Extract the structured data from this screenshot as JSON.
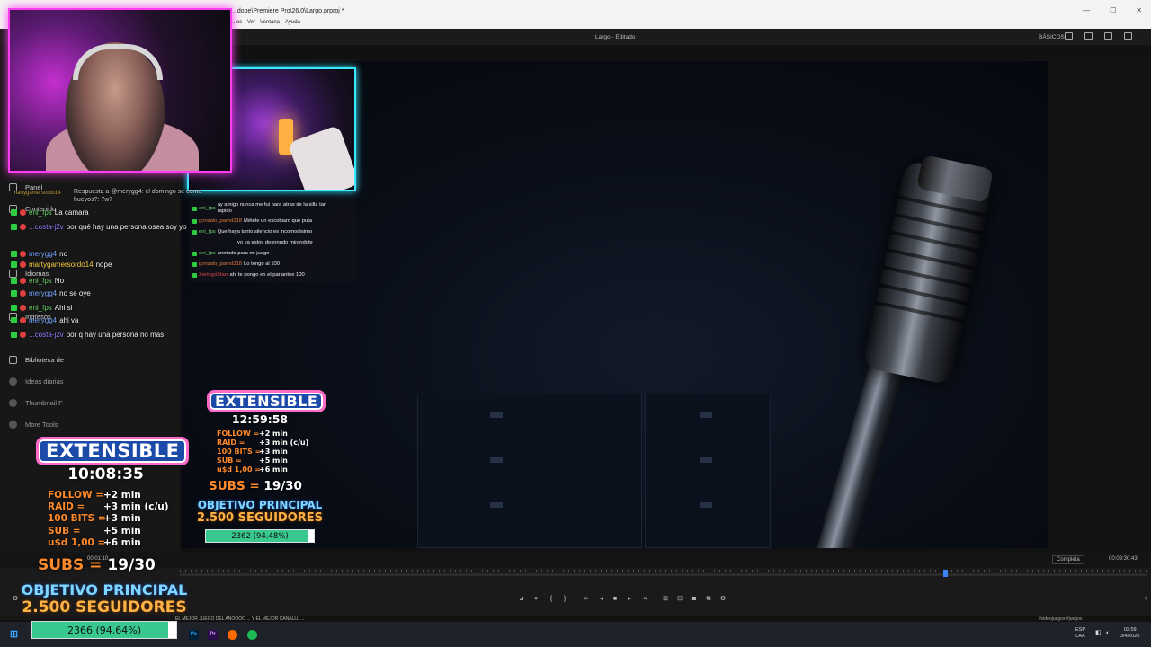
{
  "window": {
    "title": "...dobe\\Premiere Pro\\26.0\\Largo.prproj *",
    "menu": [
      "...os",
      "Ver",
      "Ventana",
      "Ayuda"
    ],
    "header_center": "Largo - Editado",
    "workspace": "BÁSICOS"
  },
  "sidebar": {
    "items": [
      {
        "label": "Panel",
        "icon": "grid-icon"
      },
      {
        "label": "Contenido",
        "icon": "content-icon"
      },
      {
        "label": "Idiomas",
        "icon": "language-icon"
      },
      {
        "label": "Ingresos",
        "icon": "money-icon"
      },
      {
        "label": "Biblioteca de",
        "icon": "library-icon"
      },
      {
        "label": "Ideas diarias",
        "icon": "ideas-icon"
      },
      {
        "label": "Thumbnail F",
        "icon": "thumbnail-icon"
      },
      {
        "label": "More Tools",
        "icon": "tools-icon"
      }
    ]
  },
  "chat_main": {
    "reply": "Respuesta a @merygg4: el domingo se come huevos?: 7w7",
    "faded_users": [
      "martygamersordo14",
      "...ecosta-j2v"
    ],
    "messages": [
      {
        "user": "eni_fps",
        "user_color": "#6bd46b",
        "text": "La camara"
      },
      {
        "user": "...costa-j2v",
        "user_color": "#9b7bff",
        "text": "por qué hay una persona osea soy yo"
      },
      {
        "user": "merygg4",
        "user_color": "#7aa7ff",
        "text": "no"
      },
      {
        "user": "martygamersordo14",
        "user_color": "#ffd24a",
        "text": "nope"
      },
      {
        "user": "eni_fps",
        "user_color": "#6bd46b",
        "text": "No"
      },
      {
        "user": "merygg4",
        "user_color": "#7aa7ff",
        "text": "no se oye"
      },
      {
        "user": "eni_fps",
        "user_color": "#6bd46b",
        "text": "Ahi si"
      },
      {
        "user": "merygg4",
        "user_color": "#7aa7ff",
        "text": "ahi va"
      },
      {
        "user": "...costa-j2v",
        "user_color": "#9b7bff",
        "text": "por q hay una persona no mas"
      }
    ]
  },
  "chat_small": {
    "messages": [
      {
        "user": "eni_fps",
        "user_color": "#6bd46b",
        "text": "ay amigo nunca me fui para atras de la silla tan rapido"
      },
      {
        "user": "gonzalo_pared318",
        "user_color": "#e07a3a",
        "text": "Métele un escobazo que puta"
      },
      {
        "user": "eni_fps",
        "user_color": "#6bd46b",
        "text": "Que haya tanto silencio es incomodisimo"
      },
      {
        "user": "",
        "user_color": "#ffffff",
        "text": "yo ya estoy desnnudo mirandote"
      },
      {
        "user": "eni_fps",
        "user_color": "#6bd46b",
        "text": "anotado para mi juego"
      },
      {
        "user": "gonzalo_pared318",
        "user_color": "#e07a3a",
        "text": "Lo tengo al 100"
      },
      {
        "user": "XeringoStarr",
        "user_color": "#e04a4a",
        "text": "ahi te pongo en el parlantee 100"
      }
    ]
  },
  "widget_big": {
    "banner": "EXTENSIBLE",
    "timer": "10:08:35",
    "rules": [
      {
        "k": "FOLLOW =",
        "v": "+2 min"
      },
      {
        "k": "RAID =",
        "v": "+3 min (c/u)"
      },
      {
        "k": "100 BITS =",
        "v": "+3 min"
      },
      {
        "k": "SUB =",
        "v": "+5 min"
      },
      {
        "k": "u$d 1,00 =",
        "v": "+6 min"
      }
    ],
    "subs_label": "SUBS =",
    "subs_value": "19/30",
    "objective_line1": "OBJETIVO PRINCIPAL",
    "objective_line2": "2.500 SEGUIDORES",
    "goal_label": "2366 (94.64%)",
    "goal_fraction": 0.9464
  },
  "widget_small": {
    "banner": "EXTENSIBLE",
    "timer": "12:59:58",
    "rules": [
      {
        "k": "FOLLOW =",
        "v": "+2 min"
      },
      {
        "k": "RAID =",
        "v": "+3 min (c/u)"
      },
      {
        "k": "100 BITS =",
        "v": "+3 min"
      },
      {
        "k": "SUB =",
        "v": "+5 min"
      },
      {
        "k": "u$d 1,00 =",
        "v": "+6 min"
      }
    ],
    "subs_label": "SUBS =",
    "subs_value": "19/30",
    "objective_line1": "OBJETIVO PRINCIPAL",
    "objective_line2": "2.500 SEGUIDORES",
    "goal_label": "2362 (94.48%)",
    "goal_fraction": 0.9448
  },
  "program_monitor": {
    "resolution": "Completa",
    "timecode": "00:09:30:43",
    "left_timecode": "00:01:10"
  },
  "ticker": {
    "left": "EL MEJOR JUEGO DEL ANOOOO ... Y EL MEJOR CANALLL ...",
    "right": "#videojuegos #juegos"
  },
  "taskbar": {
    "lang_top": "ESP",
    "lang_bottom": "LAA",
    "time": "02:59",
    "date": "3/4/2026"
  },
  "colors": {
    "accent": "#3b82f6",
    "cam1_border": "#ff3df0",
    "cam2_border": "#38e8ff",
    "rule_key": "#ff8a2b",
    "goal_fill": "#37c78f"
  }
}
